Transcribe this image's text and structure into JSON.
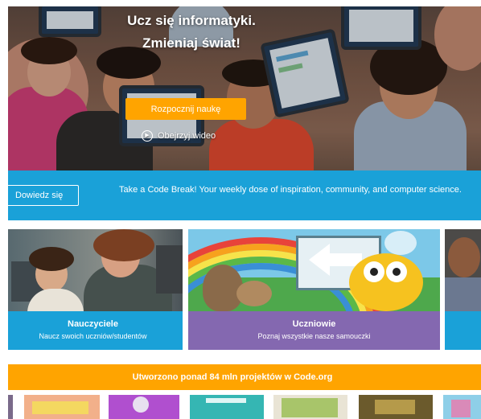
{
  "hero": {
    "title_line1": "Ucz się informatyki.",
    "title_line2": "Zmieniaj świat!",
    "cta_label": "Rozpocznij naukę",
    "video_label": "Obejrzyj wideo",
    "play_icon": "play-icon"
  },
  "banner": {
    "button_label": "Dowiedz się",
    "text": "Take a Code Break! Your weekly dose of inspiration, community, and computer science."
  },
  "cards": [
    {
      "title": "Nauczyciele",
      "subtitle": "Naucz swoich uczniów/studentów"
    },
    {
      "title": "Uczniowie",
      "subtitle": "Poznaj wszystkie nasze samouczki"
    }
  ],
  "strip": {
    "text": "Utworzono ponad 84 mln projektów w Code.org"
  },
  "colors": {
    "blue": "#1aa1d8",
    "orange": "#ffa400",
    "purple": "#8468b0"
  }
}
